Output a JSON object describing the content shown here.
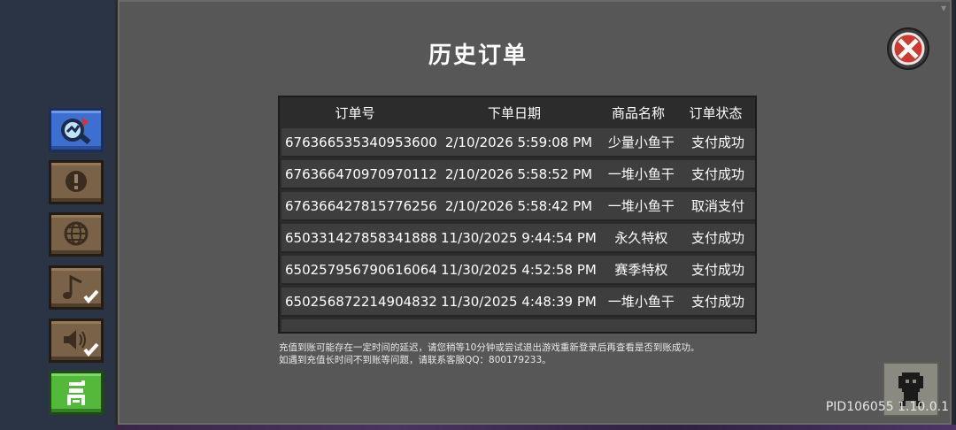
{
  "dialog": {
    "title": "历史订单",
    "close_icon": "close-icon"
  },
  "table": {
    "headers": [
      "订单号",
      "下单日期",
      "商品名称",
      "订单状态"
    ],
    "rows": [
      {
        "order_id": "676366535340953600",
        "date": "2/10/2026 5:59:08 PM",
        "product": "少量小鱼干",
        "status": "支付成功"
      },
      {
        "order_id": "676366470970970112",
        "date": "2/10/2026 5:58:52 PM",
        "product": "一堆小鱼干",
        "status": "支付成功"
      },
      {
        "order_id": "676366427815776256",
        "date": "2/10/2026 5:58:42 PM",
        "product": "一堆小鱼干",
        "status": "取消支付"
      },
      {
        "order_id": "650331427858341888",
        "date": "11/30/2025 9:44:54 PM",
        "product": "永久特权",
        "status": "支付成功"
      },
      {
        "order_id": "650257956790616064",
        "date": "11/30/2025 4:52:58 PM",
        "product": "赛季特权",
        "status": "支付成功"
      },
      {
        "order_id": "650256872214904832",
        "date": "11/30/2025 4:48:39 PM",
        "product": "一堆小鱼干",
        "status": "支付成功"
      }
    ]
  },
  "notice": {
    "line1": "充值到账可能存在一定时间的延迟，请您稍等10分钟或尝试退出游戏重新登录后再查看是否到账成功。",
    "line2": "如遇到充值长时间不到账等问题，请联系客服QQ：800179233。"
  },
  "sidebar": {
    "buttons": [
      {
        "icon": "magnifier-search-icon",
        "active": true
      },
      {
        "icon": "exclamation-icon",
        "active": false
      },
      {
        "icon": "globe-icon",
        "active": false
      },
      {
        "icon": "music-note-icon",
        "checked": true
      },
      {
        "icon": "speaker-volume-icon",
        "checked": true
      },
      {
        "icon": "exit-icon",
        "color": "#52b93a"
      }
    ]
  },
  "footer": {
    "version": "PID106055 1.10.0.1",
    "character_icon": "character-avatar-icon"
  }
}
